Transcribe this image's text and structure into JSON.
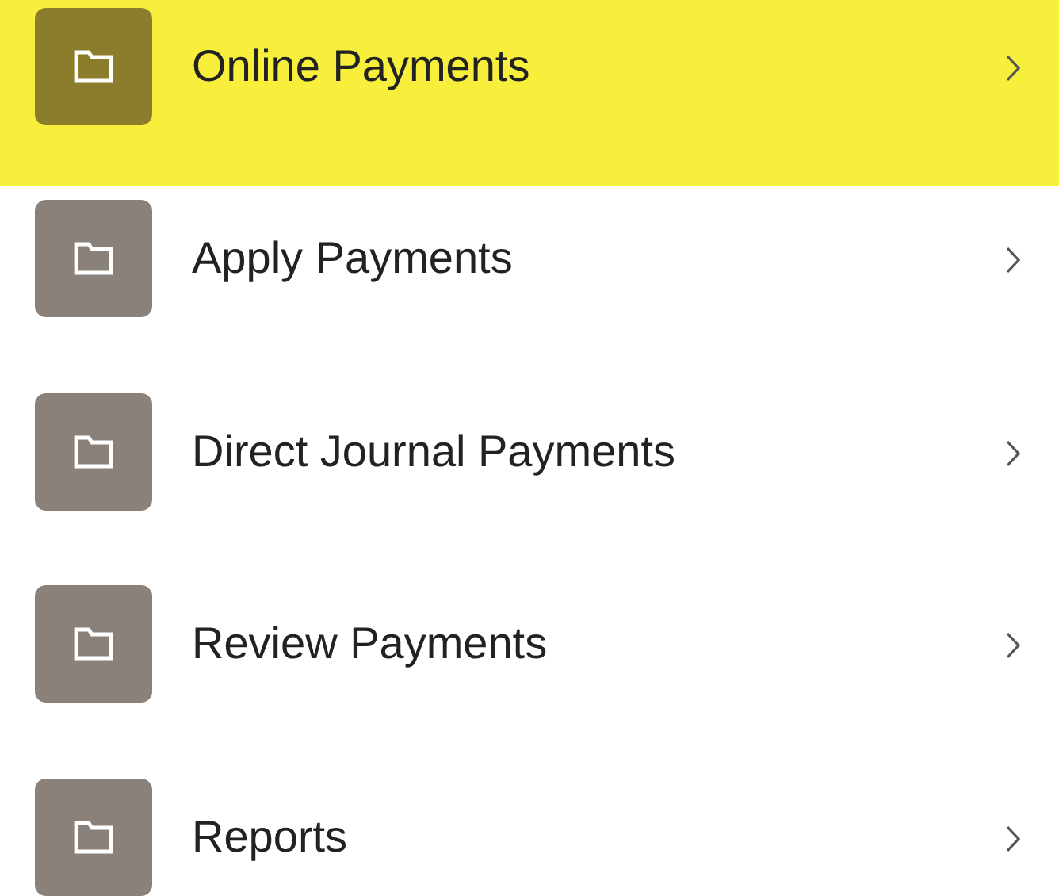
{
  "menu": {
    "items": [
      {
        "label": "Online Payments",
        "selected": true
      },
      {
        "label": "Apply Payments",
        "selected": false
      },
      {
        "label": "Direct Journal Payments",
        "selected": false
      },
      {
        "label": "Review Payments",
        "selected": false
      },
      {
        "label": "Reports",
        "selected": false
      }
    ]
  }
}
